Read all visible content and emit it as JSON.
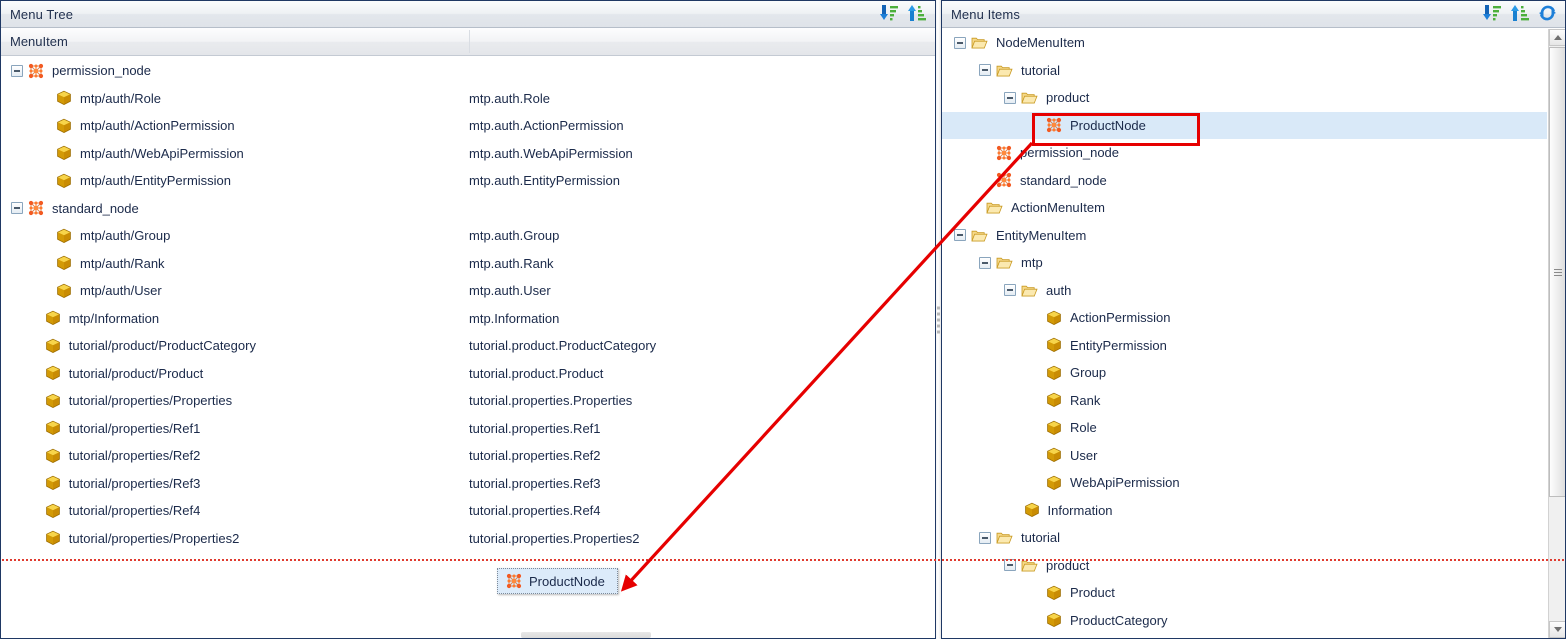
{
  "left_panel": {
    "title": "Menu Tree",
    "column_header": "MenuItem",
    "tools": [
      {
        "name": "sort-descending-icon",
        "title": "Sort descending"
      },
      {
        "name": "sort-ascending-icon",
        "title": "Sort ascending"
      }
    ],
    "rows": [
      {
        "name": "permission_node",
        "value": "",
        "icon": "node",
        "indent": 0,
        "toggle": true
      },
      {
        "name": "mtp/auth/Role",
        "value": "mtp.auth.Role",
        "icon": "cube",
        "indent": 1,
        "toggle": false
      },
      {
        "name": "mtp/auth/ActionPermission",
        "value": "mtp.auth.ActionPermission",
        "icon": "cube",
        "indent": 1,
        "toggle": false
      },
      {
        "name": "mtp/auth/WebApiPermission",
        "value": "mtp.auth.WebApiPermission",
        "icon": "cube",
        "indent": 1,
        "toggle": false
      },
      {
        "name": "mtp/auth/EntityPermission",
        "value": "mtp.auth.EntityPermission",
        "icon": "cube",
        "indent": 1,
        "toggle": false
      },
      {
        "name": "standard_node",
        "value": "",
        "icon": "node",
        "indent": 0,
        "toggle": true
      },
      {
        "name": "mtp/auth/Group",
        "value": "mtp.auth.Group",
        "icon": "cube",
        "indent": 1,
        "toggle": false
      },
      {
        "name": "mtp/auth/Rank",
        "value": "mtp.auth.Rank",
        "icon": "cube",
        "indent": 1,
        "toggle": false
      },
      {
        "name": "mtp/auth/User",
        "value": "mtp.auth.User",
        "icon": "cube",
        "indent": 1,
        "toggle": false
      },
      {
        "name": "mtp/Information",
        "value": "mtp.Information",
        "icon": "cube",
        "indent": 0.6,
        "toggle": false
      },
      {
        "name": "tutorial/product/ProductCategory",
        "value": "tutorial.product.ProductCategory",
        "icon": "cube",
        "indent": 0.6,
        "toggle": false
      },
      {
        "name": "tutorial/product/Product",
        "value": "tutorial.product.Product",
        "icon": "cube",
        "indent": 0.6,
        "toggle": false
      },
      {
        "name": "tutorial/properties/Properties",
        "value": "tutorial.properties.Properties",
        "icon": "cube",
        "indent": 0.6,
        "toggle": false
      },
      {
        "name": "tutorial/properties/Ref1",
        "value": "tutorial.properties.Ref1",
        "icon": "cube",
        "indent": 0.6,
        "toggle": false
      },
      {
        "name": "tutorial/properties/Ref2",
        "value": "tutorial.properties.Ref2",
        "icon": "cube",
        "indent": 0.6,
        "toggle": false
      },
      {
        "name": "tutorial/properties/Ref3",
        "value": "tutorial.properties.Ref3",
        "icon": "cube",
        "indent": 0.6,
        "toggle": false
      },
      {
        "name": "tutorial/properties/Ref4",
        "value": "tutorial.properties.Ref4",
        "icon": "cube",
        "indent": 0.6,
        "toggle": false
      },
      {
        "name": "tutorial/properties/Properties2",
        "value": "tutorial.properties.Properties2",
        "icon": "cube",
        "indent": 0.6,
        "toggle": false
      }
    ]
  },
  "drag": {
    "ghost_label": "ProductNode",
    "ghost_icon": "node",
    "drop_line_color": "#e03b2f"
  },
  "right_panel": {
    "title": "Menu Items",
    "tools": [
      {
        "name": "sort-descending-icon",
        "title": "Sort descending"
      },
      {
        "name": "sort-ascending-icon",
        "title": "Sort ascending"
      },
      {
        "name": "refresh-icon",
        "title": "Refresh"
      }
    ],
    "rows": [
      {
        "label": "NodeMenuItem",
        "icon": "folder",
        "indent": 0,
        "toggle": true,
        "selected": false
      },
      {
        "label": "tutorial",
        "icon": "folder",
        "indent": 1,
        "toggle": true,
        "selected": false
      },
      {
        "label": "product",
        "icon": "folder",
        "indent": 2,
        "toggle": true,
        "selected": false
      },
      {
        "label": "ProductNode",
        "icon": "node",
        "indent": 3,
        "toggle": false,
        "selected": true
      },
      {
        "label": "permission_node",
        "icon": "node",
        "indent": 1,
        "toggle": false,
        "selected": false
      },
      {
        "label": "standard_node",
        "icon": "node",
        "indent": 1,
        "toggle": false,
        "selected": false
      },
      {
        "label": "ActionMenuItem",
        "icon": "folder",
        "indent": 0.6,
        "toggle": false,
        "selected": false
      },
      {
        "label": "EntityMenuItem",
        "icon": "folder",
        "indent": 0,
        "toggle": true,
        "selected": false
      },
      {
        "label": "mtp",
        "icon": "folder",
        "indent": 1,
        "toggle": true,
        "selected": false
      },
      {
        "label": "auth",
        "icon": "folder",
        "indent": 2,
        "toggle": true,
        "selected": false
      },
      {
        "label": "ActionPermission",
        "icon": "cube",
        "indent": 3,
        "toggle": false,
        "selected": false
      },
      {
        "label": "EntityPermission",
        "icon": "cube",
        "indent": 3,
        "toggle": false,
        "selected": false
      },
      {
        "label": "Group",
        "icon": "cube",
        "indent": 3,
        "toggle": false,
        "selected": false
      },
      {
        "label": "Rank",
        "icon": "cube",
        "indent": 3,
        "toggle": false,
        "selected": false
      },
      {
        "label": "Role",
        "icon": "cube",
        "indent": 3,
        "toggle": false,
        "selected": false
      },
      {
        "label": "User",
        "icon": "cube",
        "indent": 3,
        "toggle": false,
        "selected": false
      },
      {
        "label": "WebApiPermission",
        "icon": "cube",
        "indent": 3,
        "toggle": false,
        "selected": false
      },
      {
        "label": "Information",
        "icon": "cube",
        "indent": 2.1,
        "toggle": false,
        "selected": false
      },
      {
        "label": "tutorial",
        "icon": "folder",
        "indent": 1,
        "toggle": true,
        "selected": false
      },
      {
        "label": "product",
        "icon": "folder",
        "indent": 2,
        "toggle": true,
        "selected": false
      },
      {
        "label": "Product",
        "icon": "cube",
        "indent": 3,
        "toggle": false,
        "selected": false
      },
      {
        "label": "ProductCategory",
        "icon": "cube",
        "indent": 3,
        "toggle": false,
        "selected": false
      }
    ],
    "scrollbar": {
      "name": "vertical-scrollbar"
    }
  },
  "annotations": {
    "highlight_box_color": "#e60000",
    "arrow_color": "#e60000"
  },
  "colors": {
    "panel_border": "#1f3864",
    "selection": "#d9e9f8",
    "header_text": "#22314f",
    "row_text": "#1b2a4a"
  }
}
